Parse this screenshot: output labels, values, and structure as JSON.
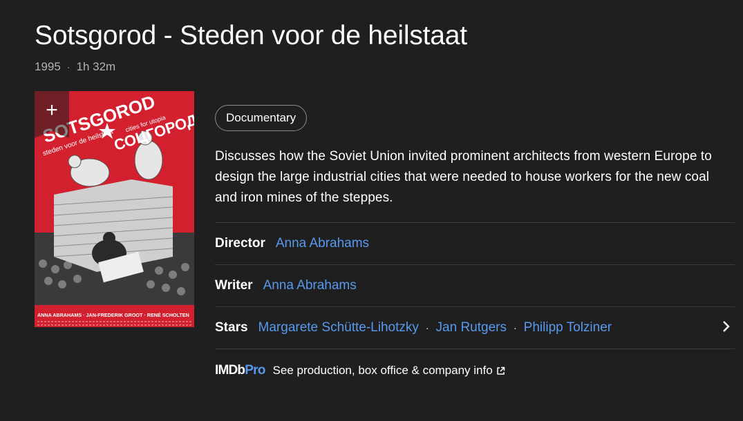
{
  "title": "Sotsgorod - Steden voor de heilstaat",
  "meta": {
    "year": "1995",
    "runtime": "1h 32m",
    "separator": "·"
  },
  "poster": {
    "add_label": "+",
    "title_red": "SOTSGOROD",
    "subtitle": "steden voor de heilstaat",
    "cities_text": "cities for utopia",
    "cyrillic": "СОЦГОРОД",
    "credit_line1": "ANNA ABRAHAMS · JAN-FREDERIK GROOT · RENÉ SCHOLTEN"
  },
  "genre": "Documentary",
  "plot": "Discusses how the Soviet Union invited prominent architects from western Europe to design the large industrial cities that were needed to house workers for the new coal and iron mines of the steppes.",
  "credits": {
    "director": {
      "label": "Director",
      "names": [
        "Anna Abrahams"
      ]
    },
    "writer": {
      "label": "Writer",
      "names": [
        "Anna Abrahams"
      ]
    },
    "stars": {
      "label": "Stars",
      "names": [
        "Margarete Schütte-Lihotzky",
        "Jan Rutgers",
        "Philipp Tolziner"
      ]
    }
  },
  "imdbpro": {
    "logo_imdb": "IMDb",
    "logo_pro": "Pro",
    "text": "See production, box office & company info"
  },
  "colors": {
    "background": "#1f1f1f",
    "link": "#5799ef",
    "divider": "#3d3d3d",
    "poster_red": "#d3202f"
  }
}
